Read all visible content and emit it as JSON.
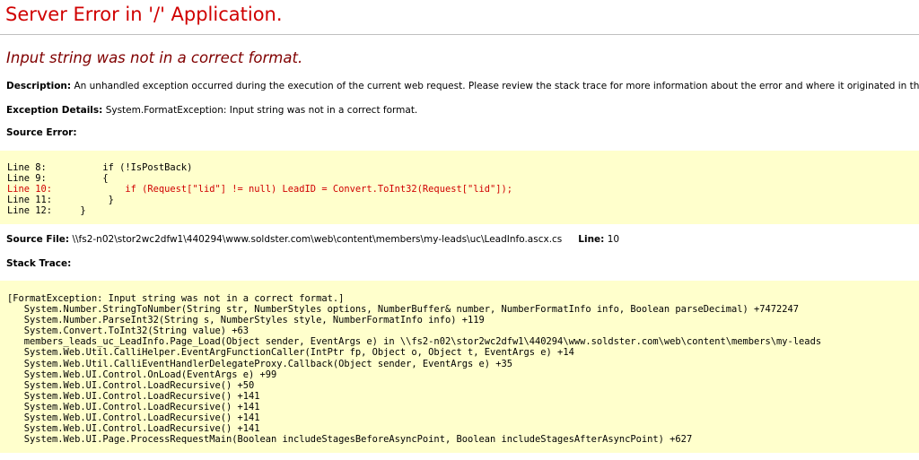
{
  "header": {
    "title": "Server Error in '/' Application."
  },
  "error": {
    "message": "Input string was not in a correct format.",
    "description_label": "Description:",
    "description_text": "An unhandled exception occurred during the execution of the current web request. Please review the stack trace for more information about the error and where it originated in the code.",
    "exception_label": "Exception Details:",
    "exception_text": "System.FormatException: Input string was not in a correct format.",
    "source_error_label": "Source Error:",
    "source_file_label": "Source File:",
    "source_file_path": "\\\\fs2-n02\\stor2wc2dfw1\\440294\\www.soldster.com\\web\\content\\members\\my-leads\\uc\\LeadInfo.ascx.cs",
    "line_label": "Line:",
    "line_number": "10",
    "stack_trace_label": "Stack Trace:"
  },
  "source_lines": [
    {
      "text": "Line 8:          if (!IsPostBack)",
      "highlight": false
    },
    {
      "text": "Line 9:          {",
      "highlight": false
    },
    {
      "text": "Line 10:             if (Request[\"lid\"] != null) LeadID = Convert.ToInt32(Request[\"lid\"]);",
      "highlight": true
    },
    {
      "text": "Line 11:          }",
      "highlight": false
    },
    {
      "text": "Line 12:     }",
      "highlight": false
    }
  ],
  "stack_lines": [
    "[FormatException: Input string was not in a correct format.]",
    "   System.Number.StringToNumber(String str, NumberStyles options, NumberBuffer& number, NumberFormatInfo info, Boolean parseDecimal) +7472247",
    "   System.Number.ParseInt32(String s, NumberStyles style, NumberFormatInfo info) +119",
    "   System.Convert.ToInt32(String value) +63",
    "   members_leads_uc_LeadInfo.Page_Load(Object sender, EventArgs e) in \\\\fs2-n02\\stor2wc2dfw1\\440294\\www.soldster.com\\web\\content\\members\\my-leads",
    "   System.Web.Util.CalliHelper.EventArgFunctionCaller(IntPtr fp, Object o, Object t, EventArgs e) +14",
    "   System.Web.Util.CalliEventHandlerDelegateProxy.Callback(Object sender, EventArgs e) +35",
    "   System.Web.UI.Control.OnLoad(EventArgs e) +99",
    "   System.Web.UI.Control.LoadRecursive() +50",
    "   System.Web.UI.Control.LoadRecursive() +141",
    "   System.Web.UI.Control.LoadRecursive() +141",
    "   System.Web.UI.Control.LoadRecursive() +141",
    "   System.Web.UI.Control.LoadRecursive() +141",
    "   System.Web.UI.Page.ProcessRequestMain(Boolean includeStagesBeforeAsyncPoint, Boolean includeStagesAfterAsyncPoint) +627"
  ],
  "colors": {
    "title": "#d00000",
    "message": "#800000",
    "code_background": "#ffffcc",
    "highlight_line": "#d00000"
  }
}
